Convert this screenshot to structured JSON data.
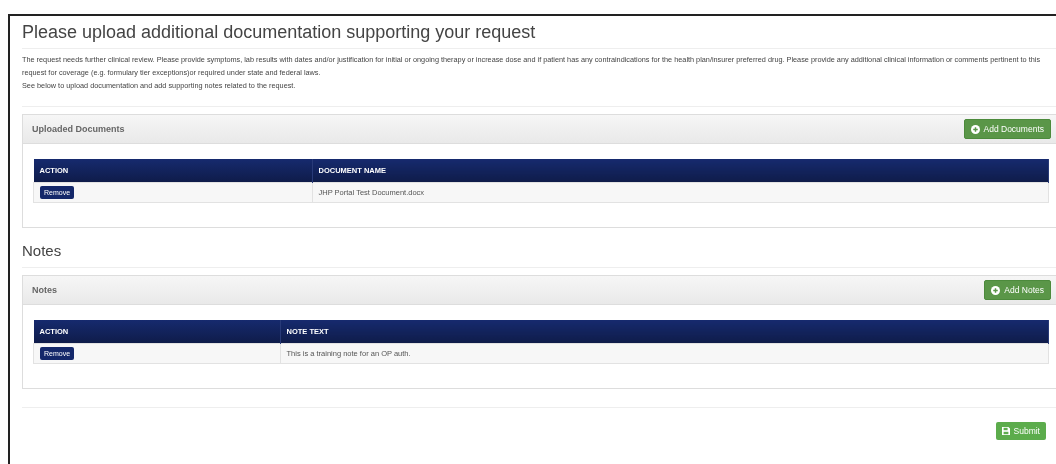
{
  "page_title": "Please upload additional documentation supporting your request",
  "intro": [
    "The request needs further clinical review. Please provide symptoms, lab results with dates and/or justification for initial or ongoing therapy or increase dose and if patient has any contraindications for the health plan/insurer preferred drug. Please provide any additional clinical information or comments pertinent to this request for coverage (e.g. formulary tier exceptions)or required under state and federal laws.",
    "See below to upload documentation and add supporting notes related to the request."
  ],
  "documents_panel": {
    "title": "Uploaded Documents",
    "add_button": "Add Documents",
    "columns": [
      "ACTION",
      "DOCUMENT NAME"
    ],
    "rows": [
      {
        "action": "Remove",
        "name": "JHP Portal Test Document.docx"
      }
    ]
  },
  "notes_heading": "Notes",
  "notes_panel": {
    "title": "Notes",
    "add_button": "Add Notes",
    "columns": [
      "ACTION",
      "NOTE TEXT"
    ],
    "rows": [
      {
        "action": "Remove",
        "name": "This is a training note for an OP auth."
      }
    ]
  },
  "submit_button": "Submit"
}
